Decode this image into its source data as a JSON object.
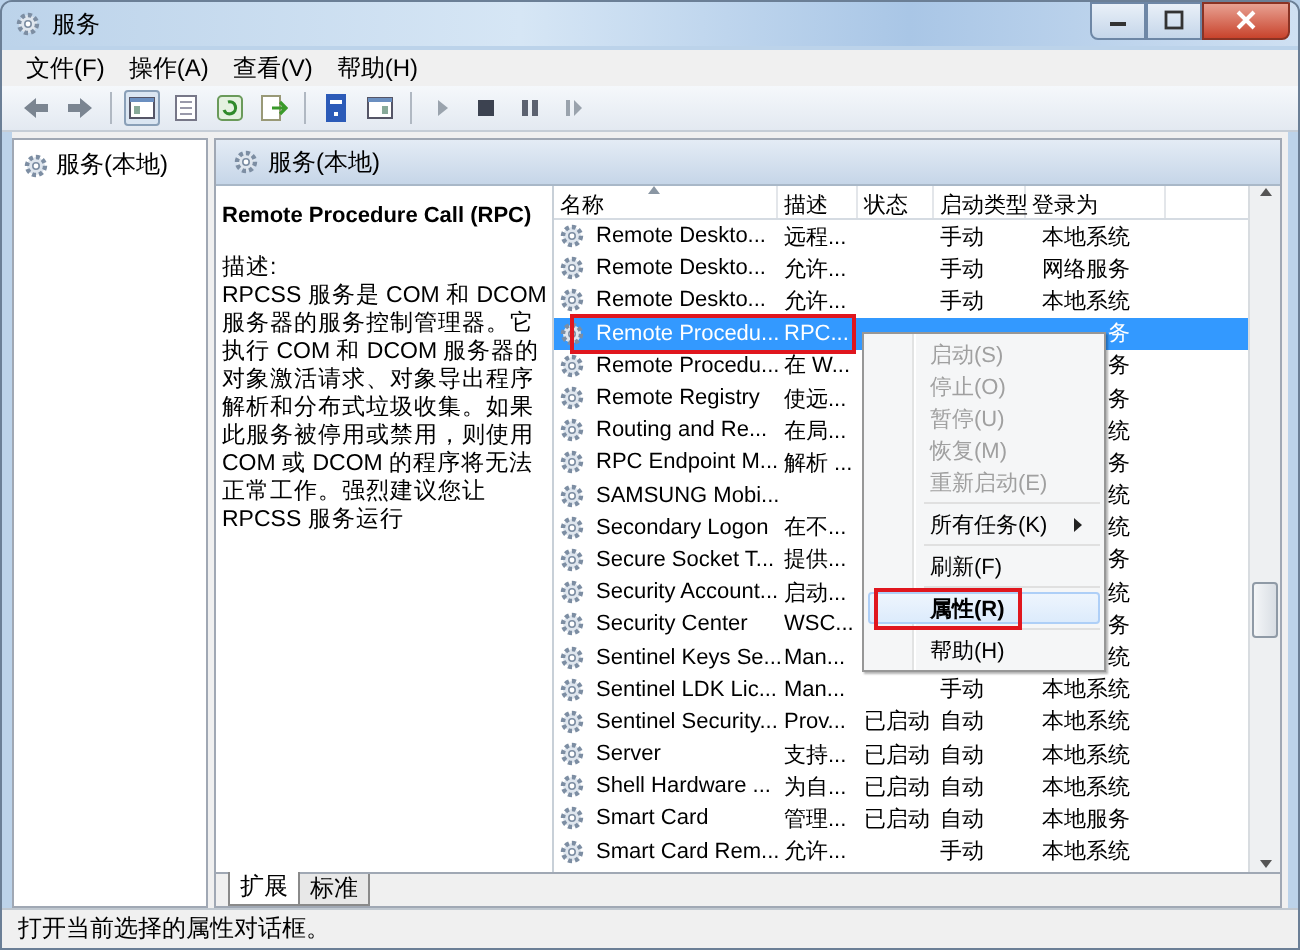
{
  "window": {
    "title": "服务"
  },
  "menubar": [
    "文件(F)",
    "操作(A)",
    "查看(V)",
    "帮助(H)"
  ],
  "tree": {
    "items": [
      {
        "label": "服务(本地)",
        "selected": false
      }
    ]
  },
  "pane_header": "服务(本地)",
  "description": {
    "title": "Remote Procedure Call (RPC)",
    "label": "描述:",
    "text": "RPCSS 服务是 COM 和 DCOM 服务器的服务控制管理器。它执行 COM 和 DCOM 服务器的对象激活请求、对象导出程序解析和分布式垃圾收集。如果此服务被停用或禁用，则使用 COM 或 DCOM 的程序将无法正常工作。强烈建议您让 RPCSS 服务运行"
  },
  "table": {
    "columns": [
      "名称",
      "描述",
      "状态",
      "启动类型",
      "登录为"
    ],
    "rows": [
      {
        "name": "Remote Deskto...",
        "desc": "远程...",
        "startup": "手动",
        "logon": "本地系统",
        "selected": false,
        "annotated": false
      },
      {
        "name": "Remote Deskto...",
        "desc": "允许...",
        "startup": "手动",
        "logon": "网络服务",
        "selected": false,
        "annotated": false
      },
      {
        "name": "Remote Deskto...",
        "desc": "允许...",
        "startup": "手动",
        "logon": "本地系统",
        "selected": false,
        "annotated": false
      },
      {
        "name": "Remote Procedu...",
        "desc": "RPC...",
        "logon": "务",
        "selected": true,
        "annotated": true
      },
      {
        "name": "Remote Procedu...",
        "desc": "在 W...",
        "logon": "务",
        "selected": false,
        "annotated": false
      },
      {
        "name": "Remote Registry",
        "desc": "使远...",
        "logon": "务",
        "selected": false,
        "annotated": false
      },
      {
        "name": "Routing and Re...",
        "desc": "在局...",
        "logon": "统",
        "selected": false,
        "annotated": false
      },
      {
        "name": "RPC Endpoint M...",
        "desc": "解析 ...",
        "logon": "务",
        "selected": false,
        "annotated": false
      },
      {
        "name": "SAMSUNG Mobi...",
        "logon": "统",
        "selected": false,
        "annotated": false
      },
      {
        "name": "Secondary Logon",
        "desc": "在不...",
        "logon": "统",
        "selected": false,
        "annotated": false
      },
      {
        "name": "Secure Socket T...",
        "desc": "提供...",
        "logon": "务",
        "selected": false,
        "annotated": false
      },
      {
        "name": "Security Account...",
        "desc": "启动...",
        "logon": "统",
        "selected": false,
        "annotated": false
      },
      {
        "name": "Security Center",
        "desc": "WSC...",
        "logon": "务",
        "selected": false,
        "annotated": false
      },
      {
        "name": "Sentinel Keys Se...",
        "desc": "Man...",
        "logon": "统",
        "selected": false,
        "annotated": false
      },
      {
        "name": "Sentinel LDK Lic...",
        "desc": "Man...",
        "startup": "手动",
        "logon": "本地系统",
        "selected": false,
        "annotated": false
      },
      {
        "name": "Sentinel Security...",
        "desc": "Prov...",
        "status": "已启动",
        "startup": "自动",
        "logon": "本地系统",
        "selected": false,
        "annotated": false
      },
      {
        "name": "Server",
        "desc": "支持...",
        "status": "已启动",
        "startup": "自动",
        "logon": "本地系统",
        "selected": false,
        "annotated": false
      },
      {
        "name": "Shell Hardware ...",
        "desc": "为自...",
        "status": "已启动",
        "startup": "自动",
        "logon": "本地系统",
        "selected": false,
        "annotated": false
      },
      {
        "name": "Smart Card",
        "desc": "管理...",
        "status": "已启动",
        "startup": "自动",
        "logon": "本地服务",
        "selected": false,
        "annotated": false
      },
      {
        "name": "Smart Card Rem...",
        "desc": "允许...",
        "startup": "手动",
        "logon": "本地系统",
        "selected": false,
        "annotated": false
      }
    ]
  },
  "context_menu": {
    "items": [
      {
        "kind": "item",
        "label": "启动(S)",
        "disabled": true,
        "default": false,
        "hovered": false,
        "submenu": false,
        "annotated": false
      },
      {
        "kind": "item",
        "label": "停止(O)",
        "disabled": true,
        "default": false,
        "hovered": false,
        "submenu": false,
        "annotated": false
      },
      {
        "kind": "item",
        "label": "暂停(U)",
        "disabled": true,
        "default": false,
        "hovered": false,
        "submenu": false,
        "annotated": false
      },
      {
        "kind": "item",
        "label": "恢复(M)",
        "disabled": true,
        "default": false,
        "hovered": false,
        "submenu": false,
        "annotated": false
      },
      {
        "kind": "item",
        "label": "重新启动(E)",
        "disabled": true,
        "default": false,
        "hovered": false,
        "submenu": false,
        "annotated": false
      },
      {
        "kind": "separator"
      },
      {
        "kind": "item",
        "label": "所有任务(K)",
        "disabled": false,
        "default": false,
        "hovered": false,
        "submenu": true,
        "annotated": false
      },
      {
        "kind": "separator"
      },
      {
        "kind": "item",
        "label": "刷新(F)",
        "disabled": false,
        "default": false,
        "hovered": false,
        "submenu": false,
        "annotated": false
      },
      {
        "kind": "separator"
      },
      {
        "kind": "item",
        "label": "属性(R)",
        "disabled": false,
        "default": true,
        "hovered": true,
        "submenu": false,
        "annotated": true
      },
      {
        "kind": "separator"
      },
      {
        "kind": "item",
        "label": "帮助(H)",
        "disabled": false,
        "default": false,
        "hovered": false,
        "submenu": false,
        "annotated": false
      }
    ]
  },
  "tabs": [
    {
      "label": "扩展",
      "selected": true
    },
    {
      "label": "标准",
      "selected": false
    }
  ],
  "status_bar": "打开当前选择的属性对话框。"
}
